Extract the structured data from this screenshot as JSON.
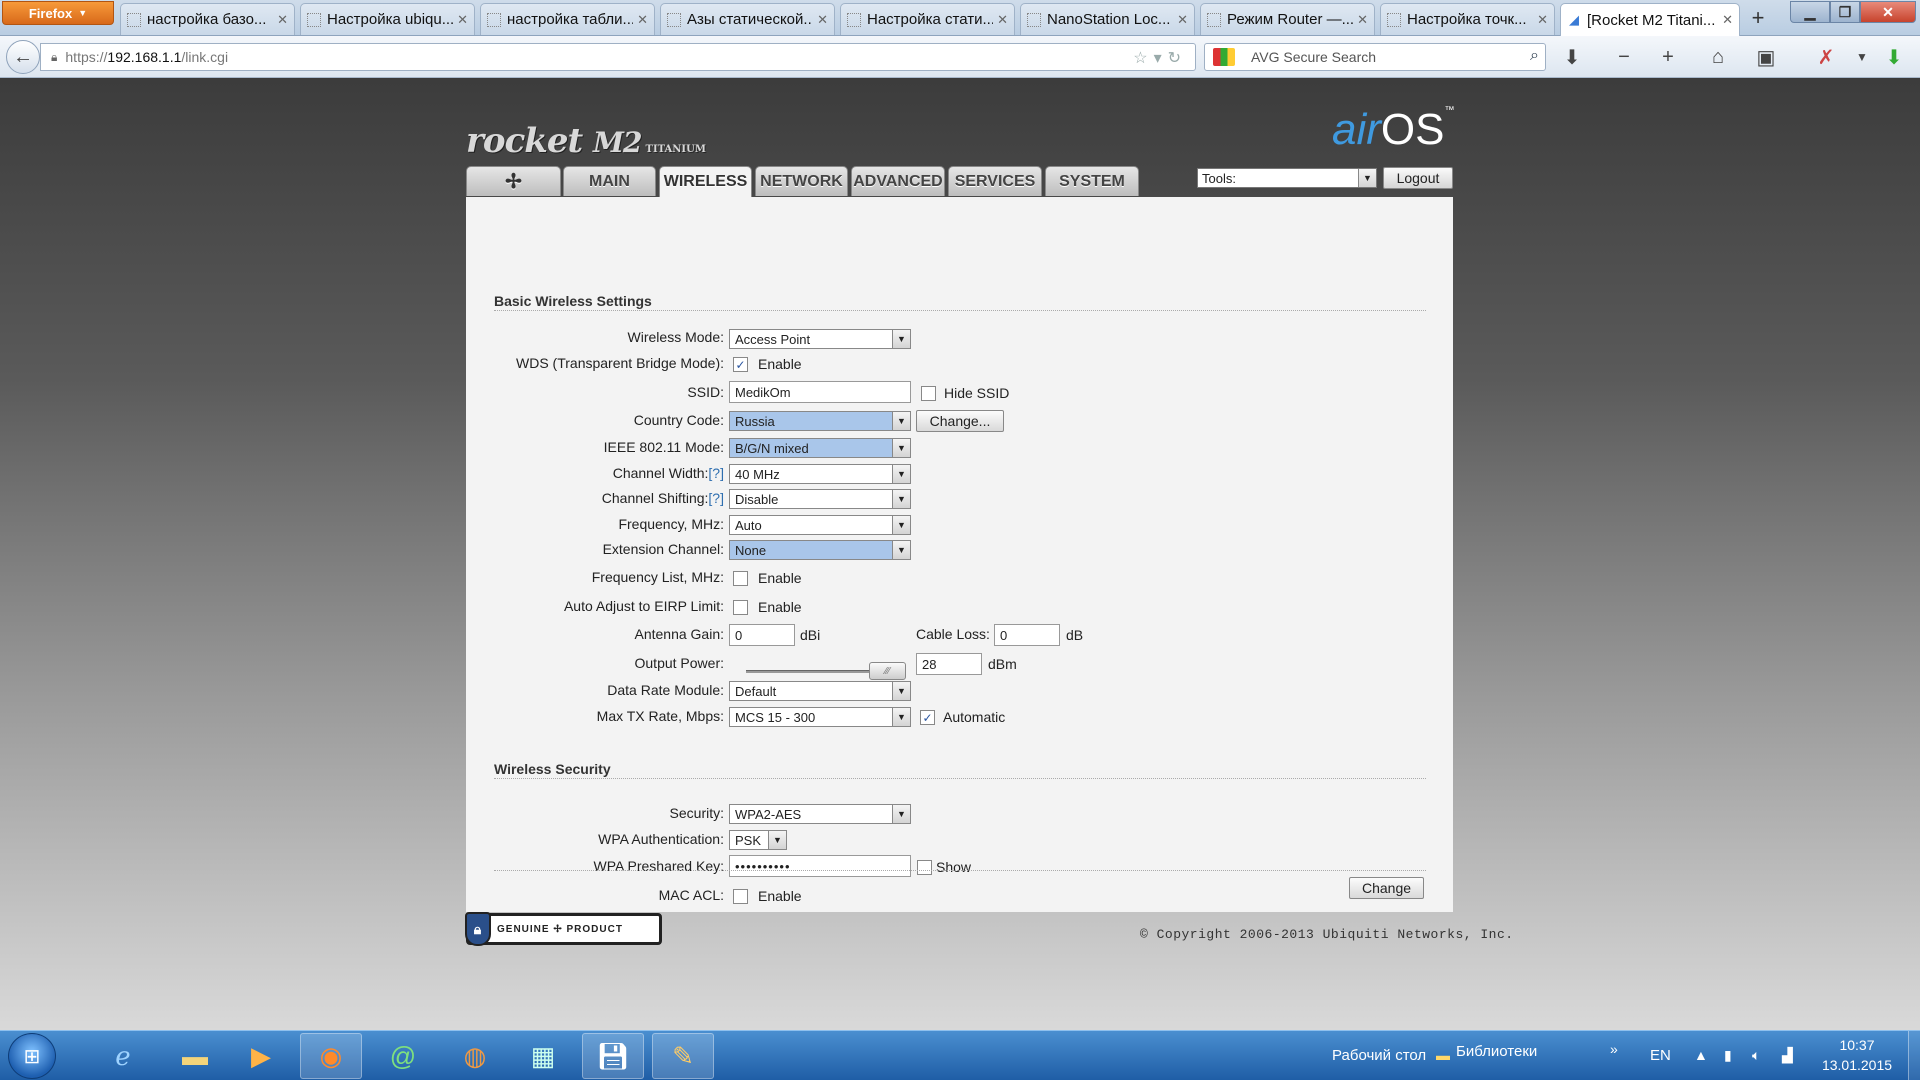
{
  "browser": {
    "menu_label": "Firefox",
    "tabs": [
      {
        "title": "настройка базо...",
        "active": false
      },
      {
        "title": "Настройка ubiqu...",
        "active": false
      },
      {
        "title": "настройка табли...",
        "active": false
      },
      {
        "title": "Азы статической...",
        "active": false
      },
      {
        "title": "Настройка стати...",
        "active": false
      },
      {
        "title": "NanoStation Loc...",
        "active": false
      },
      {
        "title": "Режим Router —...",
        "active": false
      },
      {
        "title": "Настройка точк...",
        "active": false
      },
      {
        "title": "[Rocket M2 Titani...",
        "active": true
      }
    ],
    "url": {
      "scheme": "https://",
      "host": "192.168.1.1",
      "path": "/link.cgi"
    },
    "search_placeholder": "AVG Secure Search"
  },
  "header": {
    "logo_rocket": "rocket",
    "logo_m2": "M2",
    "logo_titanium": "TITANIUM",
    "logo_air": "air",
    "logo_os": "OS",
    "logo_tm": "™",
    "nav_tabs": [
      {
        "label": "",
        "icon": "ubiquiti-logo-icon",
        "active": false
      },
      {
        "label": "MAIN",
        "active": false
      },
      {
        "label": "WIRELESS",
        "active": true
      },
      {
        "label": "NETWORK",
        "active": false
      },
      {
        "label": "ADVANCED",
        "active": false
      },
      {
        "label": "SERVICES",
        "active": false
      },
      {
        "label": "SYSTEM",
        "active": false
      }
    ],
    "tools_value": "Tools:",
    "logout_label": "Logout"
  },
  "basic": {
    "title": "Basic Wireless Settings",
    "wireless_mode": {
      "label": "Wireless Mode:",
      "value": "Access Point"
    },
    "wds": {
      "label": "WDS (Transparent Bridge Mode):",
      "checked": true,
      "option": "Enable"
    },
    "ssid": {
      "label": "SSID:",
      "value": "MedikOm",
      "hide_label": "Hide SSID",
      "hide_checked": false
    },
    "country": {
      "label": "Country Code:",
      "value": "Russia",
      "button": "Change..."
    },
    "ieee_mode": {
      "label": "IEEE 802.11 Mode:",
      "value": "B/G/N mixed"
    },
    "channel_width": {
      "label": "Channel Width:",
      "help": "[?]",
      "value": "40 MHz"
    },
    "channel_shifting": {
      "label": "Channel Shifting:",
      "help": "[?]",
      "value": "Disable"
    },
    "frequency": {
      "label": "Frequency, MHz:",
      "value": "Auto"
    },
    "extension_channel": {
      "label": "Extension Channel:",
      "value": "None"
    },
    "frequency_list": {
      "label": "Frequency List, MHz:",
      "checked": false,
      "option": "Enable"
    },
    "auto_eirp": {
      "label": "Auto Adjust to EIRP Limit:",
      "checked": false,
      "option": "Enable"
    },
    "antenna_gain": {
      "label": "Antenna Gain:",
      "value": "0",
      "unit": "dBi"
    },
    "cable_loss": {
      "label": "Cable Loss:",
      "value": "0",
      "unit": "dB"
    },
    "output_power": {
      "label": "Output Power:",
      "value": "28",
      "unit": "dBm"
    },
    "data_rate_module": {
      "label": "Data Rate Module:",
      "value": "Default"
    },
    "max_tx_rate": {
      "label": "Max TX Rate, Mbps:",
      "value": "MCS 15 - 300",
      "auto_label": "Automatic",
      "auto_checked": true
    }
  },
  "security": {
    "title": "Wireless Security",
    "security": {
      "label": "Security:",
      "value": "WPA2-AES"
    },
    "wpa_auth": {
      "label": "WPA Authentication:",
      "value": "PSK"
    },
    "wpa_key": {
      "label": "WPA Preshared Key:",
      "value": "••••••••••",
      "show_label": "Show",
      "show_checked": false
    },
    "mac_acl": {
      "label": "MAC ACL:",
      "checked": false,
      "option": "Enable"
    }
  },
  "footer": {
    "change_label": "Change",
    "genuine_text": "GENUINE ✢ PRODUCT",
    "copyright": "© Copyright 2006-2013 Ubiquiti Networks, Inc."
  },
  "taskbar": {
    "desktop_label": "Рабочий стол",
    "libraries_label": "Библиотеки",
    "lang": "EN",
    "time": "10:37",
    "date": "13.01.2015"
  }
}
